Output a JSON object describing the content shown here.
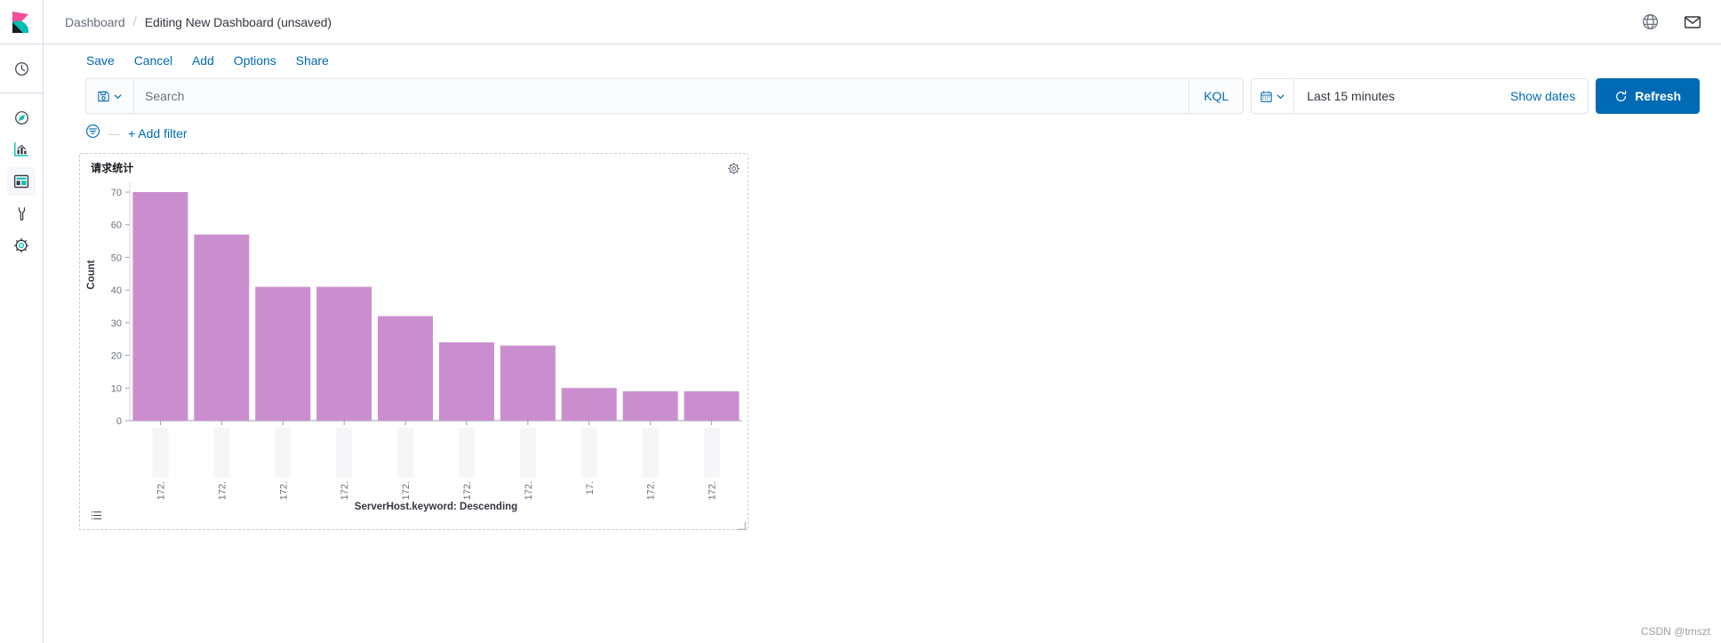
{
  "app": {
    "name": "Kibana",
    "logo_icon": "kibana-logo-icon"
  },
  "sidebar": {
    "items": [
      {
        "name": "recently-viewed",
        "icon": "clock-icon",
        "active": false
      },
      {
        "name": "discover",
        "icon": "compass-icon",
        "active": false
      },
      {
        "name": "visualize",
        "icon": "bar-chart-icon",
        "active": false
      },
      {
        "name": "dashboard",
        "icon": "dashboard-icon",
        "active": true
      },
      {
        "name": "dev-tools",
        "icon": "wrench-icon",
        "active": false
      },
      {
        "name": "management",
        "icon": "gear-icon",
        "active": false
      }
    ]
  },
  "header": {
    "breadcrumbs": [
      {
        "label": "Dashboard",
        "current": false
      },
      {
        "label": "Editing New Dashboard (unsaved)",
        "current": true
      }
    ],
    "separator": "/",
    "actions": [
      {
        "name": "help-icon",
        "icon": "help-icon"
      },
      {
        "name": "news-feed-icon",
        "icon": "envelope-icon"
      }
    ]
  },
  "topnav": {
    "items": [
      {
        "label": "Save",
        "name": "save"
      },
      {
        "label": "Cancel",
        "name": "cancel"
      },
      {
        "label": "Add",
        "name": "add"
      },
      {
        "label": "Options",
        "name": "options"
      },
      {
        "label": "Share",
        "name": "share"
      }
    ]
  },
  "query_bar": {
    "saved_query_icon": "save-disk-icon",
    "saved_query_chevron": "chevron-down-icon",
    "search_value": "",
    "search_placeholder": "Search",
    "language_label": "KQL",
    "calendar_icon": "calendar-icon",
    "calendar_chevron": "chevron-down-icon",
    "time_range": "Last 15 minutes",
    "show_dates_label": "Show dates",
    "refresh_label": "Refresh",
    "refresh_icon": "refresh-icon"
  },
  "filter_bar": {
    "filter_icon": "filter-list-icon",
    "dash": "—",
    "add_filter_label": "+ Add filter"
  },
  "panel": {
    "title": "请求统计",
    "gear_icon": "gear-icon",
    "legend_toggle_icon": "legend-list-icon",
    "resize_icon": "resize-handle-icon"
  },
  "watermark": {
    "text": "CSDN @tmszt"
  },
  "chart_data": {
    "type": "bar",
    "title": "请求统计",
    "xlabel": "ServerHost.keyword: Descending",
    "ylabel": "Count",
    "ylim": [
      0,
      73
    ],
    "yticks": [
      0,
      10,
      20,
      30,
      40,
      50,
      60,
      70
    ],
    "grid": false,
    "legend_position": "hidden",
    "bar_color": "#ca8eceff",
    "categories": [
      "172.",
      "172.",
      "172.",
      "172.",
      "172.",
      "172.",
      "172.",
      "17.",
      "172.",
      "172."
    ],
    "values": [
      70,
      57,
      41,
      41,
      32,
      24,
      23,
      10,
      9,
      9
    ],
    "series": [
      {
        "name": "Count",
        "values": [
          70,
          57,
          41,
          41,
          32,
          24,
          23,
          10,
          9,
          9
        ]
      }
    ]
  }
}
